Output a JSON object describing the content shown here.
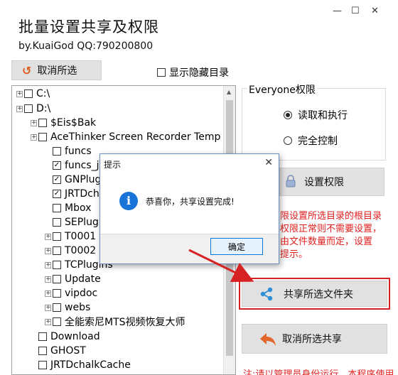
{
  "window": {
    "title": "批量设置共享及权限",
    "subtitle": "by.KuaiGod  QQ:790200800",
    "min_glyph": "—",
    "max_glyph": "☐",
    "close_glyph": "✕"
  },
  "toolbar": {
    "cancel_select_label": "取消所选",
    "show_hidden_label": "显示隐藏目录",
    "show_hidden_checked": false
  },
  "tree": {
    "nodes": [
      {
        "label": "C:\\",
        "checked": false
      },
      {
        "label": "D:\\",
        "checked": false
      },
      {
        "label": "$Eis$Bak",
        "checked": false
      },
      {
        "label": "AceThinker Screen Recorder Temp",
        "checked": false
      },
      {
        "label": "funcs",
        "checked": false
      },
      {
        "label": "funcs_jy",
        "checked": true
      },
      {
        "label": "GNPlugin",
        "checked": true
      },
      {
        "label": "JRTDchalk",
        "checked": true
      },
      {
        "label": "Mbox",
        "checked": false
      },
      {
        "label": "SEPlugin",
        "checked": false
      },
      {
        "label": "T0001",
        "checked": false
      },
      {
        "label": "T0002",
        "checked": false
      },
      {
        "label": "TCPlugins",
        "checked": false
      },
      {
        "label": "Update",
        "checked": false
      },
      {
        "label": "vipdoc",
        "checked": false
      },
      {
        "label": "webs",
        "checked": false
      },
      {
        "label": "全能索尼MTS视频恢复大师",
        "checked": false
      },
      {
        "label": "Download",
        "checked": false
      },
      {
        "label": "GHOST",
        "checked": false
      },
      {
        "label": "JRTDchalkCache",
        "checked": false
      }
    ]
  },
  "dialog": {
    "title": "提示",
    "message": "恭喜你，共享设置完成!",
    "ok_label": "确定",
    "close_glyph": "✕",
    "info_glyph": "i"
  },
  "permissions": {
    "group_label": "Everyone权限",
    "options": [
      {
        "label": "读取和执行",
        "selected": true
      },
      {
        "label": "完全控制",
        "selected": false
      }
    ],
    "set_button_label": "设置权限",
    "warning_lines": [
      "限设置所选目录的根目录",
      "权限正常则不需要设置，",
      "由文件数量而定，设置",
      "提示。"
    ]
  },
  "actions": {
    "share_label": "共享所选文件夹",
    "unshare_label": "取消所选共享",
    "bottom_note": "注:请以管理员身份运行，本程序使用"
  },
  "colors": {
    "accent_blue": "#1a73d6",
    "warning_red": "#e02020",
    "highlight_red": "#d62222"
  }
}
